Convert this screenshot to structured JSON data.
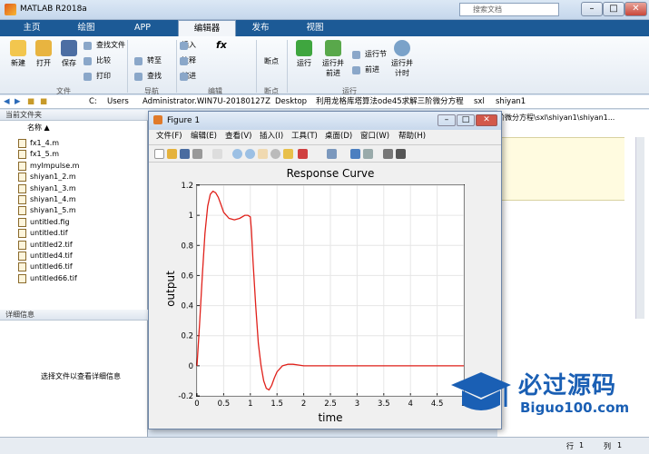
{
  "window": {
    "title": "MATLAB R2018a",
    "search_placeholder": "搜索文档"
  },
  "tabs": [
    {
      "label": "主页"
    },
    {
      "label": "绘图"
    },
    {
      "label": "APP"
    },
    {
      "label": "编辑器"
    },
    {
      "label": "发布"
    },
    {
      "label": "视图"
    }
  ],
  "ribbon": {
    "file": {
      "new": "新建",
      "open": "打开",
      "save": "保存",
      "find_files": "查找文件",
      "compare": "比较",
      "print": "打印",
      "group": "文件"
    },
    "nav": {
      "goto": "转至",
      "find": "查找",
      "group": "导航"
    },
    "edit": {
      "insert": "插入",
      "comment": "注释",
      "indent": "缩进",
      "fx": "fx",
      "group": "编辑"
    },
    "breakpoints": {
      "label": "断点",
      "group": "断点"
    },
    "run": {
      "run": "运行",
      "run_advance": "运行并\n前进",
      "run_section": "运行节",
      "advance": "前进",
      "run_time": "运行并\n计时",
      "group": "运行"
    }
  },
  "address": {
    "parts": [
      "C:",
      "Users",
      "Administrator.WIN7U-20180127Z",
      "Desktop",
      "利用龙格库塔算法ode45求解三阶微分方程",
      "sxl",
      "shiyan1"
    ]
  },
  "left": {
    "current_folder": "当前文件夹",
    "name_col": "名称 ▲",
    "files": [
      "fx1_4.m",
      "fx1_5.m",
      "myImpulse.m",
      "shiyan1_2.m",
      "shiyan1_3.m",
      "shiyan1_4.m",
      "shiyan1_5.m",
      "untitled.fig",
      "untitled.tif",
      "untitled2.tif",
      "untitled4.tif",
      "untitled6.tif",
      "untitled66.tif"
    ],
    "details": "详细信息",
    "details_hint": "选择文件以查看详细信息"
  },
  "right": {
    "path": "阶微分方程\\sxl\\shiyan1\\shiyan1..."
  },
  "figure": {
    "title": "Figure 1",
    "menus": [
      "文件(F)",
      "编辑(E)",
      "查看(V)",
      "插入(I)",
      "工具(T)",
      "桌面(D)",
      "窗口(W)",
      "帮助(H)"
    ]
  },
  "chart_data": {
    "type": "line",
    "title": "Response Curve",
    "xlabel": "time",
    "ylabel": "output",
    "xlim": [
      0,
      5
    ],
    "ylim": [
      -0.2,
      1.2
    ],
    "xticks": [
      "0",
      "0.5",
      "1",
      "1.5",
      "2",
      "2.5",
      "3",
      "3.5",
      "4",
      "4.5",
      "5"
    ],
    "yticks": [
      "-0.2",
      "0",
      "0.2",
      "0.4",
      "0.6",
      "0.8",
      "1",
      "1.2"
    ],
    "series": [
      {
        "color": "#e0201a",
        "x": [
          0,
          0.05,
          0.1,
          0.15,
          0.2,
          0.25,
          0.3,
          0.35,
          0.4,
          0.45,
          0.5,
          0.6,
          0.7,
          0.8,
          0.9,
          0.95,
          1.0,
          1.02,
          1.05,
          1.1,
          1.15,
          1.2,
          1.25,
          1.3,
          1.35,
          1.4,
          1.45,
          1.5,
          1.6,
          1.7,
          1.8,
          1.9,
          2.0,
          2.2,
          2.5,
          3,
          3.5,
          4,
          4.5,
          5
        ],
        "y": [
          0,
          0.28,
          0.6,
          0.88,
          1.06,
          1.14,
          1.16,
          1.15,
          1.12,
          1.07,
          1.02,
          0.98,
          0.97,
          0.98,
          1.0,
          1.0,
          0.99,
          0.9,
          0.7,
          0.4,
          0.15,
          0.0,
          -0.1,
          -0.15,
          -0.16,
          -0.13,
          -0.08,
          -0.04,
          0.0,
          0.01,
          0.01,
          0.005,
          0,
          0,
          0,
          0,
          0,
          0,
          0,
          0
        ]
      }
    ]
  },
  "status": {
    "row_label": "行",
    "row": "1",
    "col_label": "列",
    "col": "1"
  },
  "watermark": {
    "brand": "必过源码",
    "url": "Biguo100.com"
  }
}
